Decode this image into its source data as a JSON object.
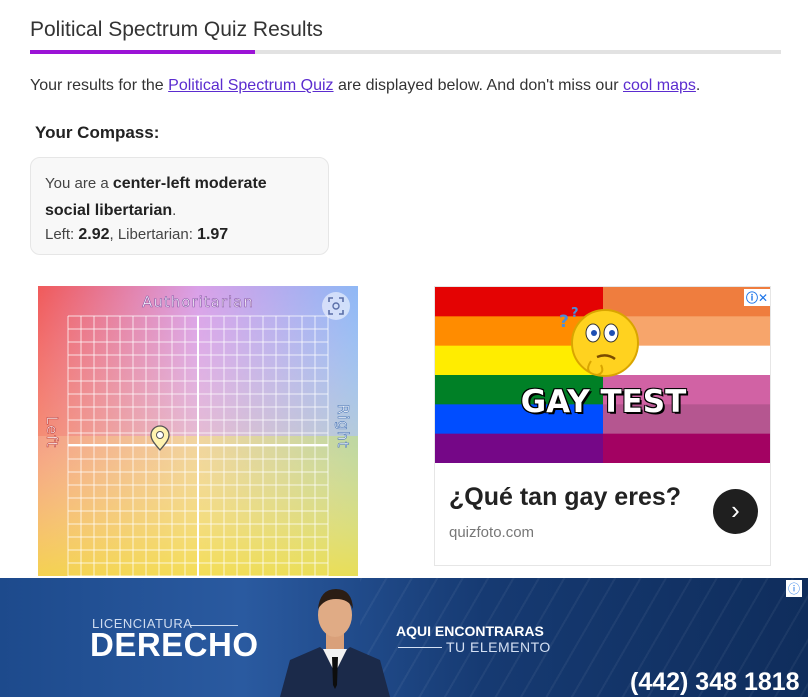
{
  "header": {
    "title": "Political Spectrum Quiz Results",
    "progress_fraction": 0.3,
    "accent_color": "#9b13d6"
  },
  "intro": {
    "prefix": "Your results for the ",
    "quiz_link": "Political Spectrum Quiz",
    "middle": " are displayed below. And don't miss our ",
    "maps_link": "cool maps",
    "suffix": "."
  },
  "compass_heading": "Your Compass:",
  "result": {
    "prefix": "You are a ",
    "label": "center-left moderate social libertarian",
    "suffix": ".",
    "left_label": "Left: ",
    "left_value": "2.92",
    "sep": ", ",
    "lib_label": "Libertarian: ",
    "lib_value": "1.97"
  },
  "compass": {
    "top_label": "Authoritarian",
    "left_label": "Left",
    "right_label": "Right",
    "icon": "fullscreen-icon",
    "marker_icon": "map-pin-icon"
  },
  "ad_right": {
    "banner_text": "GAY TEST",
    "question": "¿Qué tan gay eres?",
    "domain": "quizfoto.com",
    "arrow": "›",
    "close_glyph": "ⓘ✕",
    "flag_colors": [
      "#e40303",
      "#ff8c00",
      "#ffed00",
      "#008026",
      "#004dff",
      "#750787"
    ],
    "stripe_colors_right": [
      "#ef7d3e",
      "#f7a56b",
      "#ffffff",
      "#d162a4",
      "#b55690",
      "#a30262"
    ]
  },
  "bottom_ad": {
    "small_text": "LICENCIATURA",
    "big_text": "DERECHO",
    "aqui_line1": "AQUI ENCONTRARAS",
    "aqui_line2": "TU ELEMENTO",
    "phone": "(442) 348 1818",
    "info_glyph": "ⓘ"
  }
}
